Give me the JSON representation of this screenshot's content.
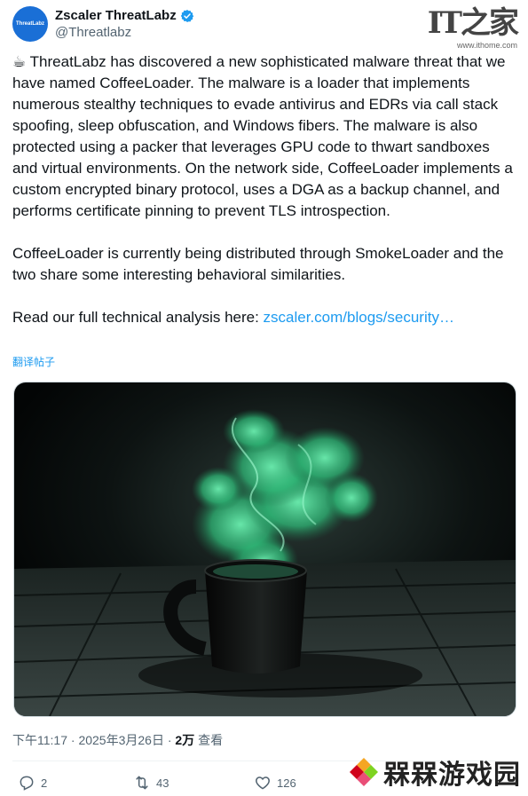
{
  "author": {
    "avatar_text": "ThreatLabz",
    "display_name": "Zscaler ThreatLabz",
    "handle": "@Threatlabz"
  },
  "watermark": {
    "it_logo": "IT之家",
    "it_url": "www.ithome.com",
    "game_text": "槑槑游戏园"
  },
  "tweet": {
    "emoji": "☕",
    "paragraph1": " ThreatLabz has discovered a new sophisticated malware threat that we have named CoffeeLoader. The malware is a loader that implements numerous stealthy techniques to evade antivirus and EDRs via call stack spoofing, sleep obfuscation, and Windows fibers. The malware is also protected using a packer that leverages GPU code to thwart sandboxes and virtual environments. On the network side, CoffeeLoader implements a custom encrypted binary protocol, uses a DGA as a backup channel, and performs certificate pinning to prevent TLS introspection.",
    "paragraph2": "CoffeeLoader is currently being distributed through SmokeLoader and the two share some interesting behavioral similarities.",
    "paragraph3_prefix": "Read our full technical analysis here: ",
    "link_text": "zscaler.com/blogs/security…",
    "translate": "翻译帖子"
  },
  "meta": {
    "time": "下午11:17",
    "sep1": " · ",
    "date": "2025年3月26日",
    "sep2": " · ",
    "views_count": "2万",
    "views_label": " 查看"
  },
  "actions": {
    "replies": "2",
    "retweets": "43",
    "likes": "126"
  },
  "colors": {
    "accent": "#1d9bf0",
    "verified": "#1d9bf0",
    "smoke": "#3fcf8e"
  }
}
